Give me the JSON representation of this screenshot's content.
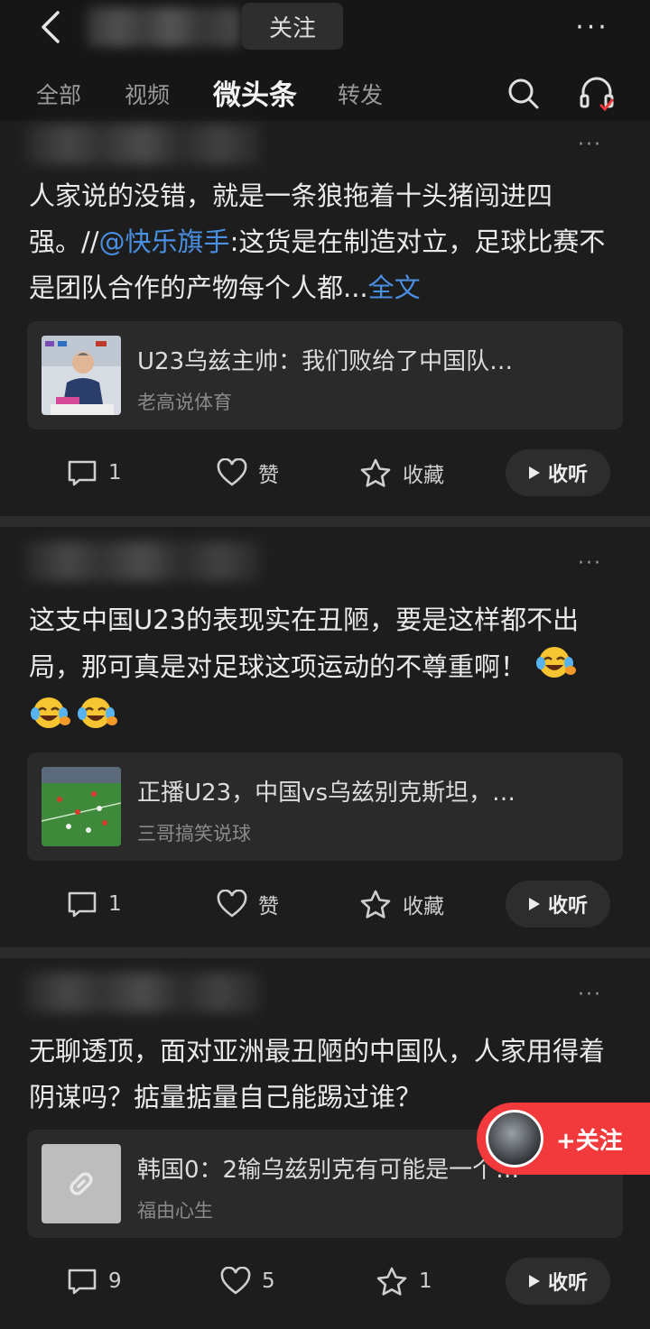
{
  "header": {
    "follow_label": "关注",
    "more_label": "···"
  },
  "tabs": [
    {
      "label": "全部"
    },
    {
      "label": "视频"
    },
    {
      "label": "微头条"
    },
    {
      "label": "转发"
    }
  ],
  "action_labels": {
    "like": "赞",
    "favorite": "收藏",
    "listen": "收听"
  },
  "posts": [
    {
      "text_before": "人家说的没错，就是一条狼拖着十头猪闯进四强。//",
      "mention": "@快乐旗手",
      "text_after": ":这货是在制造对立，足球比赛不是团队合作的产物每个人都...",
      "full_text_link": "全文",
      "card": {
        "title": "U23乌兹主帅：我们败给了中国队…",
        "source": "老高说体育"
      },
      "comments": "1",
      "likes": "赞",
      "favorites": "收藏"
    },
    {
      "text": "这支中国U23的表现实在丑陋，要是这样都不出局，那可真是对足球这项运动的不尊重啊！",
      "emoji": "crying-laughing-emoji",
      "card": {
        "title": "正播U23，中国vs乌兹别克斯坦，…",
        "source": "三哥搞笑说球"
      },
      "comments": "1",
      "likes": "赞",
      "favorites": "收藏"
    },
    {
      "text": "无聊透顶，面对亚洲最丑陋的中国队，人家用得着阴谋吗？掂量掂量自己能踢过谁？",
      "card": {
        "title": "韩国0：2输乌兹别克有可能是一个…",
        "source": "福由心生",
        "thumb_icon": "link-icon"
      },
      "comments": "9",
      "likes": "5",
      "favorites": "1"
    }
  ],
  "floating_follow": {
    "label": "+关注"
  },
  "colors": {
    "background": "#161616",
    "link": "#4a90e2",
    "follow_red": "#f2393b"
  }
}
